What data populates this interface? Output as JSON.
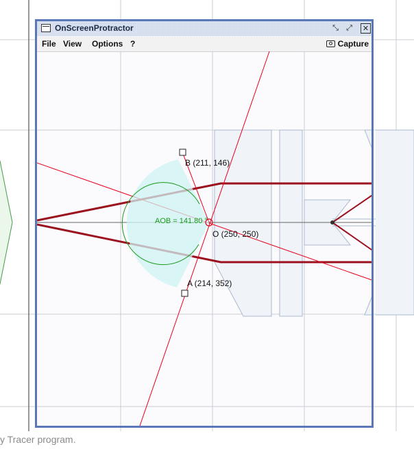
{
  "window": {
    "title": "OnScreenProtractor",
    "buttons": [
      "restore-icon",
      "maximize-icon",
      "close-icon"
    ]
  },
  "menu": {
    "file": "File",
    "view": "View",
    "options": "Options",
    "help": "?",
    "capture": "Capture"
  },
  "protractor": {
    "point_b": "B (211, 146)",
    "point_o": "O (250, 250)",
    "point_a": "A (214, 352)",
    "angle": "AOB = 141.80 °"
  },
  "caption": "y Tracer program.",
  "colors": {
    "window_border": "#5a78b8",
    "ray": "#9b111e",
    "protractor_line": "#e8001c",
    "angle_arc": "#1a9a1a"
  }
}
